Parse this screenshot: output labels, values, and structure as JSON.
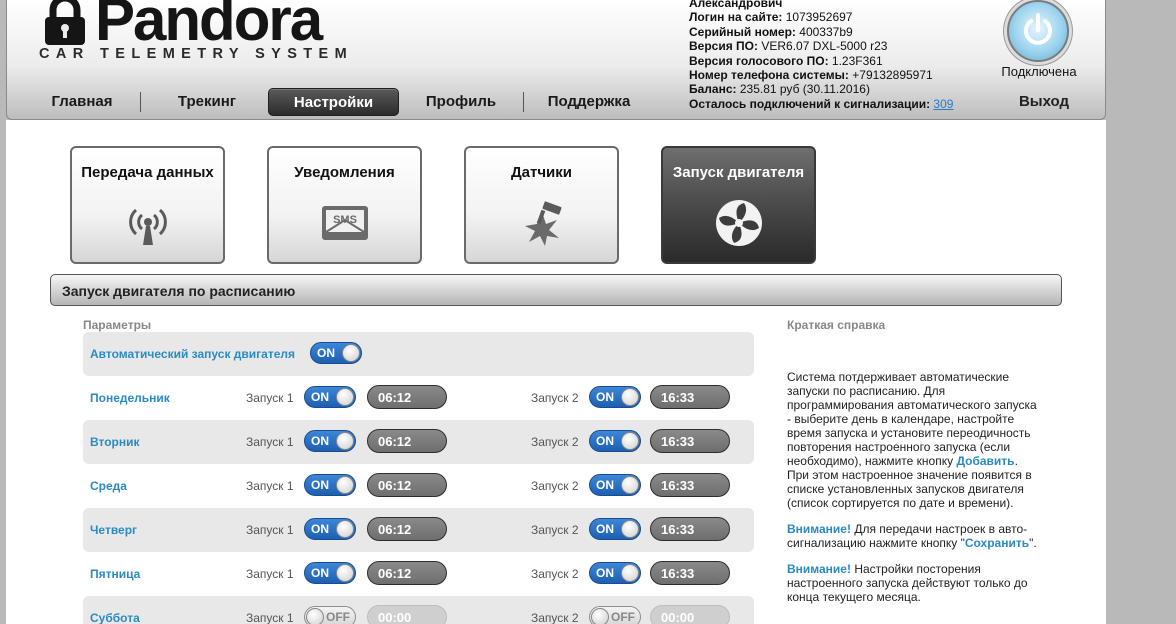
{
  "header": {
    "logo_word": "Pandora",
    "logo_subtitle": "CAR TELEMETRY SYSTEM",
    "nav": [
      {
        "label": "Главная",
        "active": false
      },
      {
        "label": "Трекинг",
        "active": false
      },
      {
        "label": "Настройки",
        "active": true
      },
      {
        "label": "Профиль",
        "active": false
      },
      {
        "label": "Поддержка",
        "active": false
      }
    ],
    "info": {
      "name": "Александрович",
      "login_label": "Логин на сайте:",
      "login_value": "1073952697",
      "serial_label": "Серийный номер:",
      "serial_value": "400337b9",
      "fw_label": "Версия ПО:",
      "fw_value": "VER6.07 DXL-5000 r23",
      "voice_label": "Версия голосового ПО:",
      "voice_value": "1.23F361",
      "phone_label": "Номер телефона системы:",
      "phone_value": "+79132895971",
      "balance_label": "Баланс:",
      "balance_value": "235.81 руб (30.11.2016)",
      "remaining_label": "Осталось подключений к сигнализации:",
      "remaining_value": "309"
    },
    "status": "Подключена",
    "logout": "Выход"
  },
  "tiles": [
    {
      "label": "Передача данных",
      "icon": "antenna-icon",
      "active": false
    },
    {
      "label": "Уведомления",
      "icon": "sms-icon",
      "active": false
    },
    {
      "label": "Датчики",
      "icon": "sensor-impact-icon",
      "active": false
    },
    {
      "label": "Запуск двигателя",
      "icon": "fan-icon",
      "active": true
    }
  ],
  "section_title": "Запуск двигателя по расписанию",
  "params_label": "Параметры",
  "auto_start": {
    "label": "Автоматический запуск двигателя",
    "toggle": "ON"
  },
  "launch1_label": "Запуск 1",
  "launch2_label": "Запуск 2",
  "days": [
    {
      "name": "Понедельник",
      "t1": "ON",
      "time1": "06:12",
      "t2": "ON",
      "time2": "16:33"
    },
    {
      "name": "Вторник",
      "t1": "ON",
      "time1": "06:12",
      "t2": "ON",
      "time2": "16:33"
    },
    {
      "name": "Среда",
      "t1": "ON",
      "time1": "06:12",
      "t2": "ON",
      "time2": "16:33"
    },
    {
      "name": "Четверг",
      "t1": "ON",
      "time1": "06:12",
      "t2": "ON",
      "time2": "16:33"
    },
    {
      "name": "Пятница",
      "t1": "ON",
      "time1": "06:12",
      "t2": "ON",
      "time2": "16:33"
    },
    {
      "name": "Суббота",
      "t1": "OFF",
      "time1": "00:00",
      "t2": "OFF",
      "time2": "00:00"
    }
  ],
  "help": {
    "title": "Краткая справка",
    "p1_a": "Система потдерживает автоматические запуски по расписанию. Для программирования автоматического запуска - выберите день в календаре, настройте время запуска и установите переодичность повторения настроенного запуска (если необходимо), нажмите кнопку ",
    "p1_link": "Добавить",
    "p1_b": ". При этом настроенное значение появится в списке установленных запусков двигателя (список сортируется по дате и времени).",
    "p2_warn": "Внимание!",
    "p2_a": " Для передачи настроек в авто-сигнализацию нажмите кнопку \"",
    "p2_link": "Сохранить",
    "p2_b": "\".",
    "p3_warn": "Внимание!",
    "p3_a": " Настройки посторения настроенного запуска действуют только до конца текущего месяца."
  },
  "colors": {
    "accent": "#2a8ac4",
    "toggle_on": "#2f74c8",
    "time_on": "#7a7a7a"
  }
}
